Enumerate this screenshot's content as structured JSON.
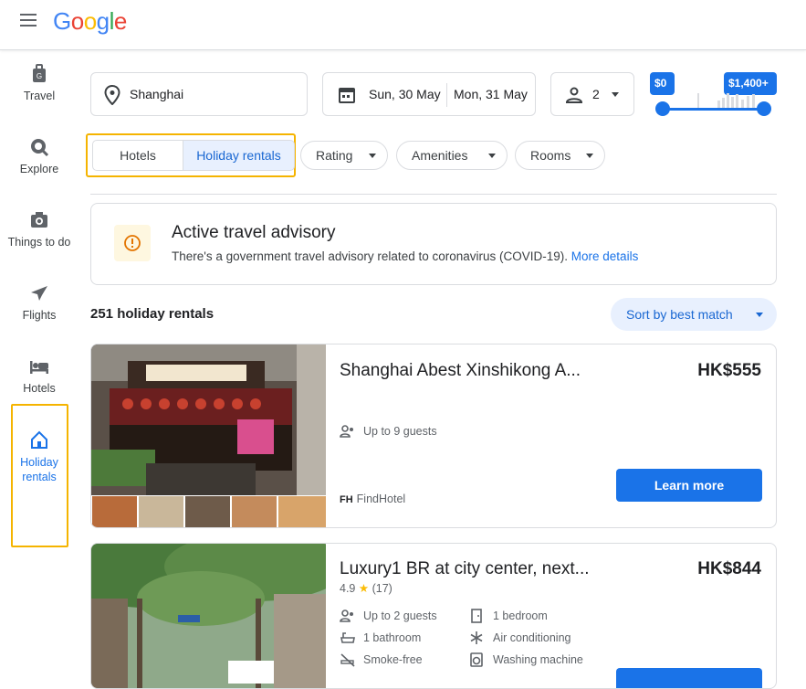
{
  "header": {
    "logo": "Google"
  },
  "sidebar": {
    "items": [
      {
        "label": "Travel"
      },
      {
        "label": "Explore"
      },
      {
        "label": "Things to do"
      },
      {
        "label": "Flights"
      },
      {
        "label": "Hotels"
      },
      {
        "label": "Holiday rentals",
        "active": true
      }
    ]
  },
  "search": {
    "location": "Shanghai",
    "checkin": "Sun, 30 May",
    "checkout": "Mon, 31 May",
    "guests": "2",
    "price_min": "$0",
    "price_max": "$1,400+"
  },
  "filters": {
    "tabs": [
      {
        "label": "Hotels",
        "selected": false
      },
      {
        "label": "Holiday rentals",
        "selected": true
      }
    ],
    "chips": [
      {
        "label": "Rating"
      },
      {
        "label": "Amenities"
      },
      {
        "label": "Rooms"
      }
    ]
  },
  "advisory": {
    "title": "Active travel advisory",
    "text": "There's a government travel advisory related to coronavirus (COVID-19).",
    "link": "More details"
  },
  "results": {
    "count": "251 holiday rentals",
    "sort_label": "Sort by best match",
    "listings": [
      {
        "title": "Shanghai Abest Xinshikong A...",
        "price": "HK$555",
        "amenities": [
          "Up to 9 guests"
        ],
        "provider_logo": "FH",
        "provider": "FindHotel",
        "cta": "Learn more"
      },
      {
        "title": "Luxury1 BR at city center, next...",
        "price": "HK$844",
        "rating": "4.9",
        "star": "★",
        "reviews": "(17)",
        "amenities": [
          "Up to 2 guests",
          "1 bedroom",
          "1 bathroom",
          "Air conditioning",
          "Smoke-free",
          "Washing machine"
        ]
      }
    ]
  },
  "colors": {
    "accent": "#1a73e8",
    "highlight": "#f5b400",
    "selected_bg": "#e8f0fe"
  }
}
